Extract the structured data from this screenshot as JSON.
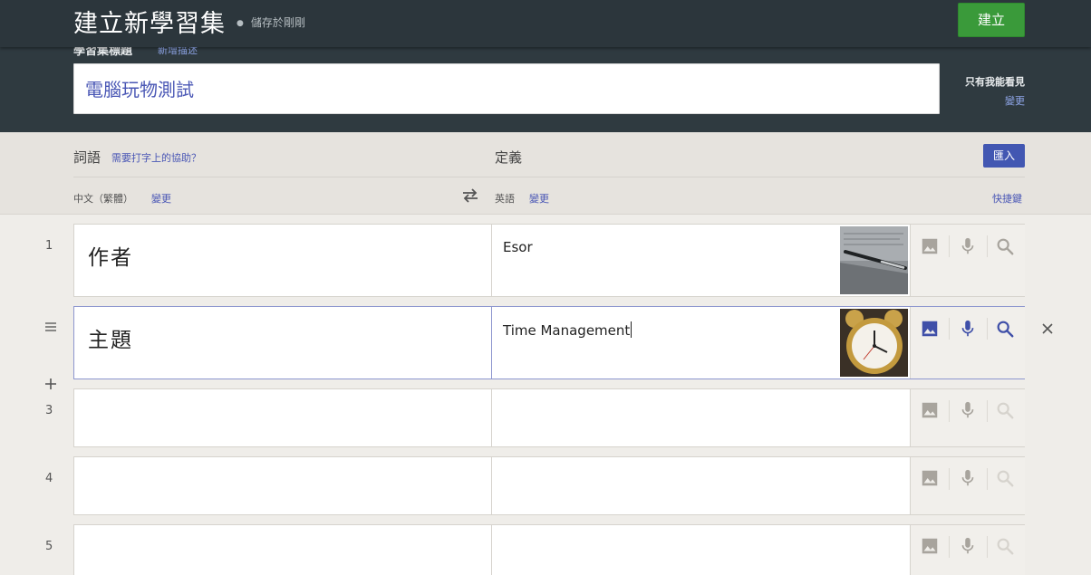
{
  "header": {
    "title": "建立新學習集",
    "save_status": "儲存於剛剛",
    "create_label": "建立",
    "set_title_label": "學習集標題",
    "add_description": "新增描述",
    "set_title_value": "電腦玩物測試",
    "visibility_label": "只有我能看見",
    "visibility_change": "變更"
  },
  "columns": {
    "term_label": "詞語",
    "typing_help": "需要打字上的協助？",
    "definition_label": "定義",
    "import_label": "匯入",
    "term_language": "中文（繁體）",
    "term_language_change": "變更",
    "definition_language": "英語",
    "definition_language_change": "變更",
    "shortcuts": "快捷鍵"
  },
  "rows": [
    {
      "number": "1",
      "term": "作者",
      "definition": "Esor",
      "image": "pen-on-notepad-photo"
    },
    {
      "number": "",
      "term": "主題",
      "definition": "Time Management",
      "image": "alarm-clock-photo",
      "active": true
    },
    {
      "number": "3",
      "term": "",
      "definition": ""
    },
    {
      "number": "4",
      "term": "",
      "definition": ""
    },
    {
      "number": "5",
      "term": "",
      "definition": ""
    }
  ],
  "icons": {
    "image": "image-icon",
    "mic": "microphone-icon",
    "search": "search-icon",
    "drag": "drag-handle-icon",
    "add": "plus-icon",
    "delete": "close-icon",
    "swap": "swap-arrows-icon"
  },
  "colors": {
    "header_bg": "#2f3a40",
    "create_button": "#3a9a3a",
    "link_blue": "#4a57b5",
    "import_button": "#4257b2",
    "active_icon": "#3f4fa8",
    "inactive_icon": "#a8a49d"
  }
}
